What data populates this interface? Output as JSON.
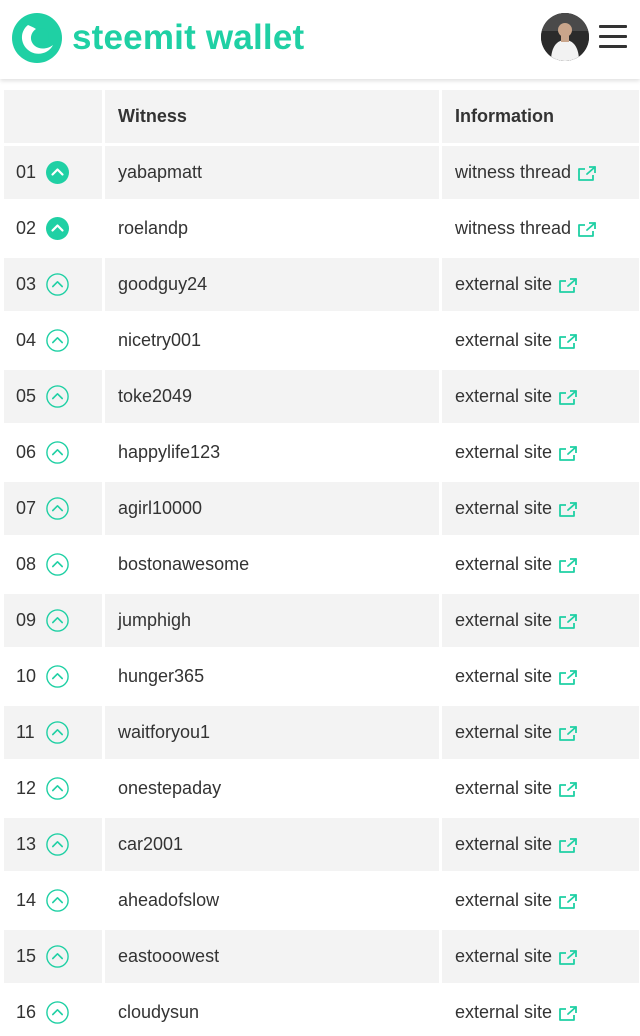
{
  "header": {
    "brand": "steemit wallet",
    "brand_color": "#1fd0a4",
    "logo_icon": "steemit-logo-icon",
    "avatar_icon": "user-avatar",
    "menu_icon": "hamburger-menu-icon"
  },
  "table": {
    "columns": [
      "",
      "Witness",
      "Information"
    ],
    "rows": [
      {
        "rank": "01",
        "voted": true,
        "name": "yabapmatt",
        "info": "witness thread"
      },
      {
        "rank": "02",
        "voted": true,
        "name": "roelandp",
        "info": "witness thread"
      },
      {
        "rank": "03",
        "voted": false,
        "name": "goodguy24",
        "info": "external site"
      },
      {
        "rank": "04",
        "voted": false,
        "name": "nicetry001",
        "info": "external site"
      },
      {
        "rank": "05",
        "voted": false,
        "name": "toke2049",
        "info": "external site"
      },
      {
        "rank": "06",
        "voted": false,
        "name": "happylife123",
        "info": "external site"
      },
      {
        "rank": "07",
        "voted": false,
        "name": "agirl10000",
        "info": "external site"
      },
      {
        "rank": "08",
        "voted": false,
        "name": "bostonawesome",
        "info": "external site"
      },
      {
        "rank": "09",
        "voted": false,
        "name": "jumphigh",
        "info": "external site"
      },
      {
        "rank": "10",
        "voted": false,
        "name": "hunger365",
        "info": "external site"
      },
      {
        "rank": "11",
        "voted": false,
        "name": "waitforyou1",
        "info": "external site"
      },
      {
        "rank": "12",
        "voted": false,
        "name": "onestepaday",
        "info": "external site"
      },
      {
        "rank": "13",
        "voted": false,
        "name": "car2001",
        "info": "external site"
      },
      {
        "rank": "14",
        "voted": false,
        "name": "aheadofslow",
        "info": "external site"
      },
      {
        "rank": "15",
        "voted": false,
        "name": "eastooowest",
        "info": "external site"
      },
      {
        "rank": "16",
        "voted": false,
        "name": "cloudysun",
        "info": "external site"
      }
    ]
  },
  "icons": {
    "vote": "upvote-chevron-icon",
    "external": "external-link-icon"
  },
  "colors": {
    "accent": "#1fd0a4",
    "text": "#333333",
    "row_alt": "#f3f3f3"
  }
}
